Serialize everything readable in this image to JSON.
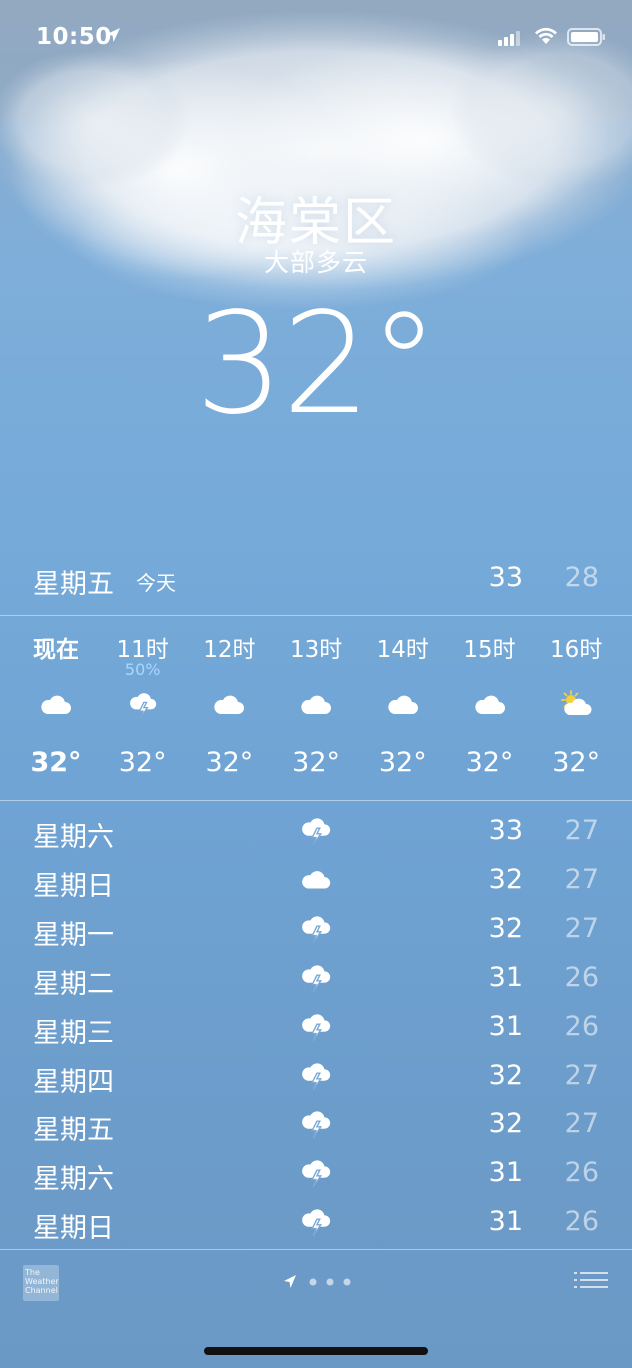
{
  "status_bar": {
    "time": "10:50"
  },
  "location": {
    "city": "海棠区",
    "condition": "大部多云",
    "current_temp": "32°"
  },
  "today": {
    "day": "星期五",
    "label": "今天",
    "high": "33",
    "low": "28"
  },
  "hourly": [
    {
      "label": "现在",
      "pop": "",
      "icon": "cloud-icon",
      "temp": "32°"
    },
    {
      "label": "11时",
      "pop": "50%",
      "icon": "thunderstorm-icon",
      "temp": "32°"
    },
    {
      "label": "12时",
      "pop": "",
      "icon": "cloud-icon",
      "temp": "32°"
    },
    {
      "label": "13时",
      "pop": "",
      "icon": "cloud-icon",
      "temp": "32°"
    },
    {
      "label": "14时",
      "pop": "",
      "icon": "cloud-icon",
      "temp": "32°"
    },
    {
      "label": "15时",
      "pop": "",
      "icon": "cloud-icon",
      "temp": "32°"
    },
    {
      "label": "16时",
      "pop": "",
      "icon": "partly-sunny-icon",
      "temp": "32°"
    }
  ],
  "daily": [
    {
      "day": "星期六",
      "icon": "thunderstorm-icon",
      "high": "33",
      "low": "27"
    },
    {
      "day": "星期日",
      "icon": "cloud-icon",
      "high": "32",
      "low": "27"
    },
    {
      "day": "星期一",
      "icon": "thunderstorm-icon",
      "high": "32",
      "low": "27"
    },
    {
      "day": "星期二",
      "icon": "thunderstorm-icon",
      "high": "31",
      "low": "26"
    },
    {
      "day": "星期三",
      "icon": "thunderstorm-icon",
      "high": "31",
      "low": "26"
    },
    {
      "day": "星期四",
      "icon": "thunderstorm-icon",
      "high": "32",
      "low": "27"
    },
    {
      "day": "星期五",
      "icon": "thunderstorm-icon",
      "high": "32",
      "low": "27"
    },
    {
      "day": "星期六",
      "icon": "thunderstorm-icon",
      "high": "31",
      "low": "26"
    },
    {
      "day": "星期日",
      "icon": "thunderstorm-icon",
      "high": "31",
      "low": "26"
    }
  ],
  "footer": {
    "weather_channel_logo": "The Weather Channel",
    "pages": 3
  }
}
